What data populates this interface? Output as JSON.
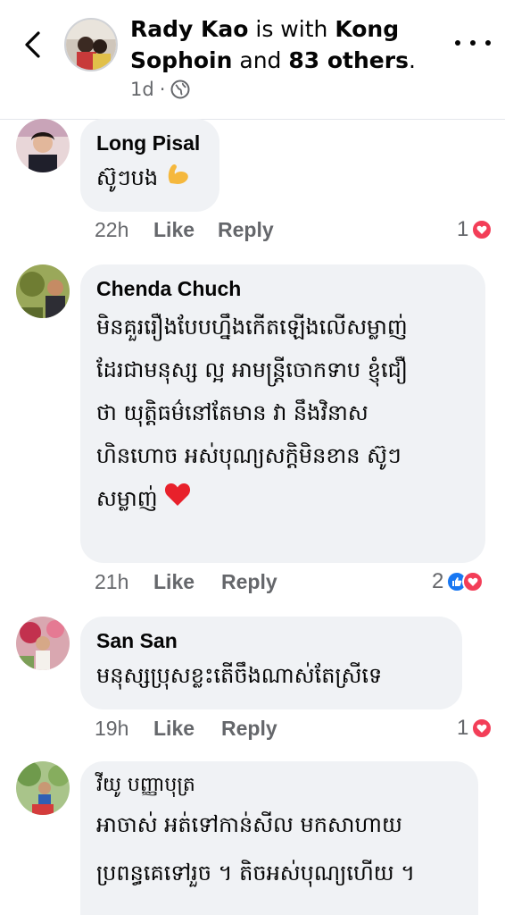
{
  "header": {
    "author": "Rady Kao",
    "with_text": "is with",
    "tagged": "Kong Sophoin",
    "and_text": "and",
    "others": "83 others",
    "period": ".",
    "time": "1d",
    "separator": "·",
    "audience_icon": "globe-icon"
  },
  "comments": [
    {
      "author": "Long Pisal",
      "text": "ស៊ូៗបង",
      "emoji": "flexed-biceps",
      "time": "22h",
      "like": "Like",
      "reply": "Reply",
      "reaction_count": "1",
      "reactions": [
        "love"
      ]
    },
    {
      "author": "Chenda Chuch",
      "text": "មិនគួររឿងបែបហ្នឹងកើតឡើងលើសម្លាញ់\nដែរជាមនុស្ស ល្អ អាមន្ត្រីចោកទាប ខ្ញុំជឿ\nថា យុត្តិធម៌នៅតែមាន វា នឹងវិនាស\nហិនហោច អស់បុណ្យសក្តិមិនខាន ស៊ូៗ\nសម្លាញ់",
      "emoji": "red-heart",
      "time": "21h",
      "like": "Like",
      "reply": "Reply",
      "reaction_count": "2",
      "reactions": [
        "like",
        "love"
      ]
    },
    {
      "author": "San San",
      "text": "មនុស្សប្រុសខ្លះតើចឹងណាស់តែស្រីទេ",
      "time": "19h",
      "like": "Like",
      "reply": "Reply",
      "reaction_count": "1",
      "reactions": [
        "love"
      ]
    },
    {
      "author": "វីយូ បញ្ញាបុត្រ",
      "text": "អាចាស់ អត់ទៅកាន់សីល  មកសាហាយ\nប្រពន្ធគេទៅរួច ។ តិចអស់បុណ្យហើយ ។"
    }
  ],
  "colors": {
    "bubble": "#f0f2f5",
    "secondary_text": "#65676b",
    "love": "#f33e58",
    "like": "#1877f2"
  }
}
